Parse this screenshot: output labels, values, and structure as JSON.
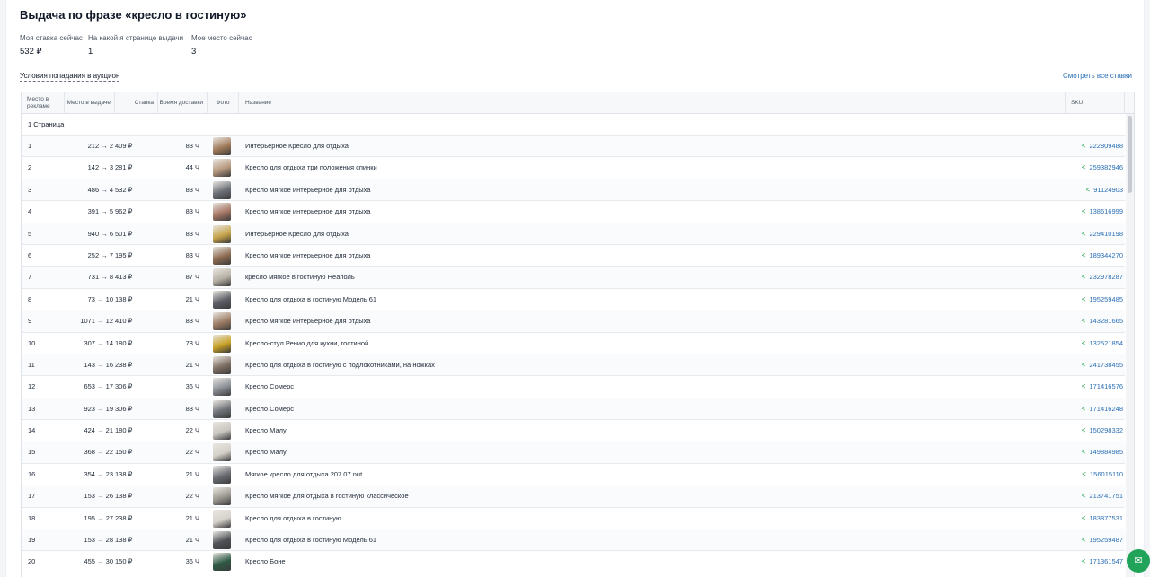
{
  "title": "Выдача по фразе «кресло в гостиную»",
  "stats": [
    {
      "label": "Моя ставка сейчас",
      "value": "532 ₽"
    },
    {
      "label": "На какой я странице выдачи",
      "value": "1"
    },
    {
      "label": "Мое место сейчас",
      "value": "3"
    }
  ],
  "conditions_link": "Условия попадания в аукцион",
  "all_bids_link": "Смотреть все ставки",
  "table": {
    "headers": {
      "ad_place": "Место в рекламе",
      "search_place": "Место в выдаче",
      "bid": "Ставка",
      "delivery": "Время доставки",
      "photo": "Фото",
      "name": "Название",
      "sku": "SKU"
    },
    "page_group": "1 Страница",
    "rows": [
      {
        "ad": "1",
        "pos": "212 → 2",
        "bid": "409 ₽",
        "del": "83 Ч",
        "photo_color": "#a07a5a",
        "name": "Интерьерное Кресло для отдыха",
        "sku": "222809488"
      },
      {
        "ad": "2",
        "pos": "142 → 3",
        "bid": "281 ₽",
        "del": "44 Ч",
        "photo_color": "#b89a80",
        "name": "Кресло для отдыха три положения спинки",
        "sku": "259382946"
      },
      {
        "ad": "3",
        "pos": "486 → 4",
        "bid": "532 ₽",
        "del": "83 Ч",
        "photo_color": "#6b6f76",
        "name": "Кресло мягкое интерьерное для отдыха",
        "sku": "91124903"
      },
      {
        "ad": "4",
        "pos": "391 → 5",
        "bid": "962 ₽",
        "del": "83 Ч",
        "photo_color": "#a77766",
        "name": "Кресло мягкое интерьерное для отдыха",
        "sku": "138616999"
      },
      {
        "ad": "5",
        "pos": "940 → 6",
        "bid": "501 ₽",
        "del": "83 Ч",
        "photo_color": "#c7a44a",
        "name": "Интерьерное Кресло для отдыха",
        "sku": "229410198"
      },
      {
        "ad": "6",
        "pos": "252 → 7",
        "bid": "195 ₽",
        "del": "83 Ч",
        "photo_color": "#8d6b52",
        "name": "Кресло мягкое интерьерное для отдыха",
        "sku": "189344270"
      },
      {
        "ad": "7",
        "pos": "731 → 8",
        "bid": "413 ₽",
        "del": "87 Ч",
        "photo_color": "#b7b1a6",
        "name": "кресло мягкое в гостиную Неаполь",
        "sku": "232978287"
      },
      {
        "ad": "8",
        "pos": "73 → 10",
        "bid": "138 ₽",
        "del": "21 Ч",
        "photo_color": "#5c5f66",
        "name": "Кресло для отдыха в гостиную Модель 61",
        "sku": "195259485"
      },
      {
        "ad": "9",
        "pos": "1071 → 12",
        "bid": "410 ₽",
        "del": "83 Ч",
        "photo_color": "#9a7a63",
        "name": "Кресло мягкое интерьерное для отдыха",
        "sku": "143281665"
      },
      {
        "ad": "10",
        "pos": "307 → 14",
        "bid": "180 ₽",
        "del": "78 Ч",
        "photo_color": "#c9a227",
        "name": "Кресло-стул Ренио для кухни, гостиной",
        "sku": "132521854"
      },
      {
        "ad": "11",
        "pos": "143 → 16",
        "bid": "238 ₽",
        "del": "21 Ч",
        "photo_color": "#7d6d63",
        "name": "Кресло для отдыха в гостиную с подлокотниками, на ножках",
        "sku": "241738455"
      },
      {
        "ad": "12",
        "pos": "653 → 17",
        "bid": "306 ₽",
        "del": "36 Ч",
        "photo_color": "#8a8f96",
        "name": "Кресло Сомерс",
        "sku": "171416576"
      },
      {
        "ad": "13",
        "pos": "923 → 19",
        "bid": "306 ₽",
        "del": "83 Ч",
        "photo_color": "#6e7278",
        "name": "Кресло Сомерс",
        "sku": "171416248"
      },
      {
        "ad": "14",
        "pos": "424 → 21",
        "bid": "180 ₽",
        "del": "22 Ч",
        "photo_color": "#c9c6c0",
        "name": "Кресло Малу",
        "sku": "150298332"
      },
      {
        "ad": "15",
        "pos": "368 → 22",
        "bid": "150 ₽",
        "del": "22 Ч",
        "photo_color": "#d4d0c9",
        "name": "Кресло Малу",
        "sku": "149884985"
      },
      {
        "ad": "16",
        "pos": "354 → 23",
        "bid": "138 ₽",
        "del": "21 Ч",
        "photo_color": "#6a6d73",
        "name": "Мягкое кресло для отдыха 207 07 nut",
        "sku": "156015110"
      },
      {
        "ad": "17",
        "pos": "153 → 26",
        "bid": "138 ₽",
        "del": "22 Ч",
        "photo_color": "#9a9790",
        "name": "Кресло мягкое для отдыха в гостиную классическое",
        "sku": "213741751"
      },
      {
        "ad": "18",
        "pos": "195 → 27",
        "bid": "238 ₽",
        "del": "21 Ч",
        "photo_color": "#d6d2cc",
        "name": "Кресло для отдыха в гостиную",
        "sku": "183877531"
      },
      {
        "ad": "19",
        "pos": "153 → 28",
        "bid": "138 ₽",
        "del": "21 Ч",
        "photo_color": "#4f5257",
        "name": "Кресло для отдыха в гостиную Модель 61",
        "sku": "195259487"
      },
      {
        "ad": "20",
        "pos": "455 → 30",
        "bid": "150 ₽",
        "del": "36 Ч",
        "photo_color": "#2f5a45",
        "name": "Кресло Боне",
        "sku": "171361547"
      }
    ]
  },
  "icons": {
    "share": "share-icon",
    "chat": "chat-icon"
  },
  "colors": {
    "accent_link": "#2a6fb5",
    "share_green": "#22a04b",
    "fab_green": "#21a35a"
  }
}
